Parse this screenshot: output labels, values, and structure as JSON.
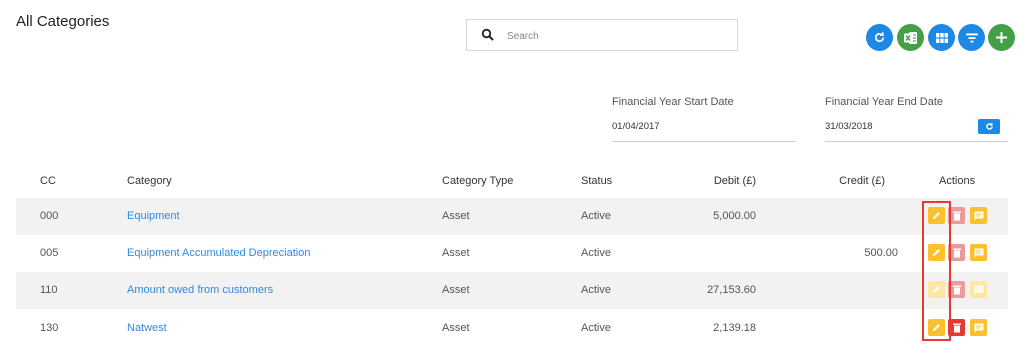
{
  "header": {
    "title": "All Categories",
    "search_placeholder": "Search"
  },
  "toolbar": {
    "buttons": [
      {
        "name": "refresh-button",
        "icon": "refresh-icon",
        "color": "#1e88e5"
      },
      {
        "name": "excel-export-button",
        "icon": "excel-icon",
        "color": "#43a047"
      },
      {
        "name": "grid-view-button",
        "icon": "grid-icon",
        "color": "#1e88e5"
      },
      {
        "name": "filter-button",
        "icon": "filter-icon",
        "color": "#1e88e5"
      },
      {
        "name": "add-button",
        "icon": "plus-icon",
        "color": "#43a047"
      }
    ]
  },
  "financial_year": {
    "start_label": "Financial Year Start Date",
    "start_value": "01/04/2017",
    "end_label": "Financial Year End Date",
    "end_value": "31/03/2018"
  },
  "table": {
    "columns": [
      "CC",
      "Category",
      "Category Type",
      "Status",
      "Debit (£)",
      "Credit (£)",
      "Actions"
    ],
    "rows": [
      {
        "cc": "000",
        "category": "Equipment",
        "type": "Asset",
        "status": "Active",
        "debit": "5,000.00",
        "credit": "",
        "delete_enabled": false,
        "edit_enabled": true
      },
      {
        "cc": "005",
        "category": "Equipment Accumulated Depreciation",
        "type": "Asset",
        "status": "Active",
        "debit": "",
        "credit": "500.00",
        "delete_enabled": false,
        "edit_enabled": true
      },
      {
        "cc": "110",
        "category": "Amount owed from customers",
        "type": "Asset",
        "status": "Active",
        "debit": "27,153.60",
        "credit": "",
        "delete_enabled": false,
        "edit_enabled": false
      },
      {
        "cc": "130",
        "category": "Natwest",
        "type": "Asset",
        "status": "Active",
        "debit": "2,139.18",
        "credit": "",
        "delete_enabled": true,
        "edit_enabled": true
      }
    ]
  },
  "colors": {
    "edit": "#fbc02d",
    "delete": "#e53935",
    "comment": "#fbc02d",
    "link": "#2f8be0",
    "highlight": "#e53935"
  }
}
